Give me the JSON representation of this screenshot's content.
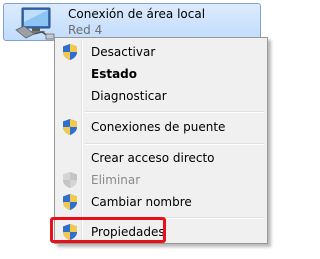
{
  "connection": {
    "name": "Conexión de área local",
    "network": "Red  4",
    "icon": "network-adapter-icon"
  },
  "menu": {
    "items": [
      {
        "label": "Desactivar",
        "icon": "uac-shield-icon",
        "bold": false,
        "enabled": true
      },
      {
        "label": "Estado",
        "icon": null,
        "bold": true,
        "enabled": true
      },
      {
        "label": "Diagnosticar",
        "icon": null,
        "bold": false,
        "enabled": true
      },
      {
        "label": "Conexiones de puente",
        "icon": "uac-shield-icon",
        "bold": false,
        "enabled": true
      },
      {
        "label": "Crear acceso directo",
        "icon": null,
        "bold": false,
        "enabled": true
      },
      {
        "label": "Eliminar",
        "icon": "uac-shield-icon",
        "bold": false,
        "enabled": false
      },
      {
        "label": "Cambiar nombre",
        "icon": "uac-shield-icon",
        "bold": false,
        "enabled": true
      },
      {
        "label": "Propiedades",
        "icon": "uac-shield-icon",
        "bold": false,
        "enabled": true
      }
    ]
  },
  "annotation": {
    "highlight_color": "#e8101b",
    "highlighted_item": "Propiedades"
  }
}
